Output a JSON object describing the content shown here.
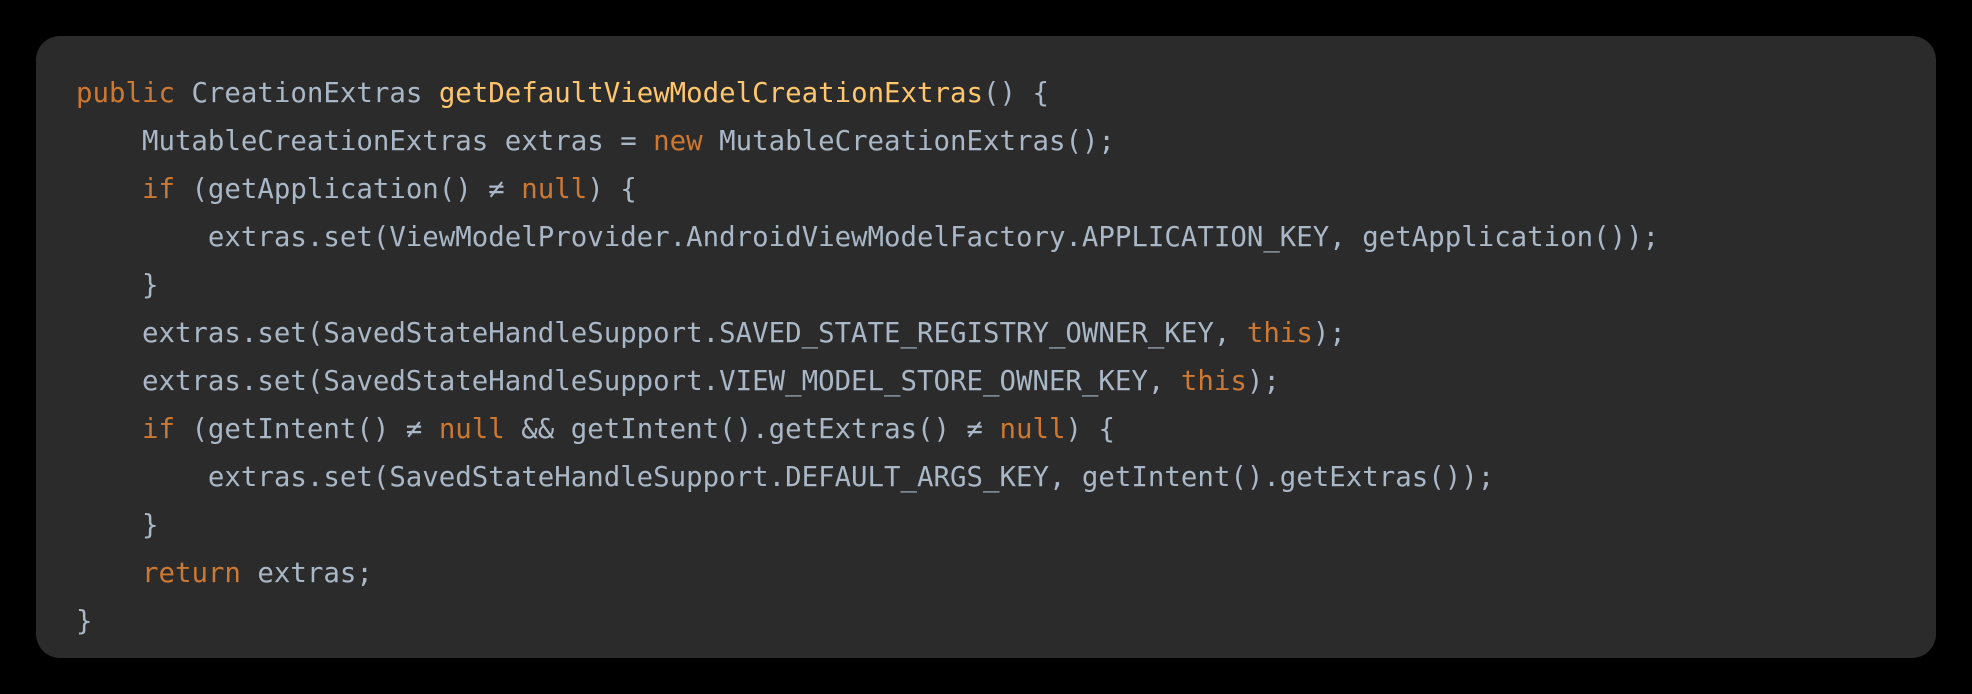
{
  "colors": {
    "background": "#000000",
    "card": "#2b2b2b",
    "plain": "#a9b7c6",
    "keyword": "#cc7832",
    "function": "#ffc66d"
  },
  "code_lines": [
    [
      {
        "t": "public",
        "k": "kw"
      },
      {
        "t": " CreationExtras ",
        "k": "plain"
      },
      {
        "t": "getDefaultViewModelCreationExtras",
        "k": "fn"
      },
      {
        "t": "() {",
        "k": "plain"
      }
    ],
    [
      {
        "t": "    MutableCreationExtras extras = ",
        "k": "plain"
      },
      {
        "t": "new",
        "k": "kw"
      },
      {
        "t": " MutableCreationExtras();",
        "k": "plain"
      }
    ],
    [
      {
        "t": "    ",
        "k": "plain"
      },
      {
        "t": "if",
        "k": "kw"
      },
      {
        "t": " (getApplication() ≠ ",
        "k": "plain"
      },
      {
        "t": "null",
        "k": "kw"
      },
      {
        "t": ") {",
        "k": "plain"
      }
    ],
    [
      {
        "t": "        extras.set(ViewModelProvider.AndroidViewModelFactory.APPLICATION_KEY, getApplication());",
        "k": "plain"
      }
    ],
    [
      {
        "t": "    }",
        "k": "plain"
      }
    ],
    [
      {
        "t": "    extras.set(SavedStateHandleSupport.SAVED_STATE_REGISTRY_OWNER_KEY, ",
        "k": "plain"
      },
      {
        "t": "this",
        "k": "kw"
      },
      {
        "t": ");",
        "k": "plain"
      }
    ],
    [
      {
        "t": "    extras.set(SavedStateHandleSupport.VIEW_MODEL_STORE_OWNER_KEY, ",
        "k": "plain"
      },
      {
        "t": "this",
        "k": "kw"
      },
      {
        "t": ");",
        "k": "plain"
      }
    ],
    [
      {
        "t": "    ",
        "k": "plain"
      },
      {
        "t": "if",
        "k": "kw"
      },
      {
        "t": " (getIntent() ≠ ",
        "k": "plain"
      },
      {
        "t": "null",
        "k": "kw"
      },
      {
        "t": " && getIntent().getExtras() ≠ ",
        "k": "plain"
      },
      {
        "t": "null",
        "k": "kw"
      },
      {
        "t": ") {",
        "k": "plain"
      }
    ],
    [
      {
        "t": "        extras.set(SavedStateHandleSupport.DEFAULT_ARGS_KEY, getIntent().getExtras());",
        "k": "plain"
      }
    ],
    [
      {
        "t": "    }",
        "k": "plain"
      }
    ],
    [
      {
        "t": "    ",
        "k": "plain"
      },
      {
        "t": "return",
        "k": "kw"
      },
      {
        "t": " extras;",
        "k": "plain"
      }
    ],
    [
      {
        "t": "}",
        "k": "plain"
      }
    ]
  ]
}
